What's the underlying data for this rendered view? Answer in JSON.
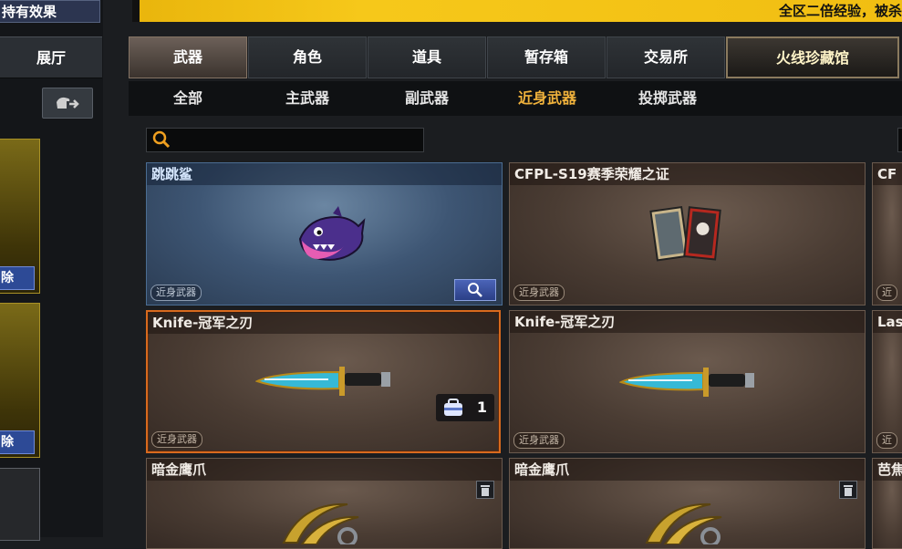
{
  "left": {
    "held_effect_label": "持有效果",
    "hall_label": "展厅",
    "remove_label": "除"
  },
  "banner": {
    "text": "全区二倍经验，被杀"
  },
  "main_tabs": [
    "武器",
    "角色",
    "道具",
    "暂存箱",
    "交易所",
    "火线珍藏馆"
  ],
  "sub_tabs": [
    "全部",
    "主武器",
    "副武器",
    "近身武器",
    "投掷武器"
  ],
  "search": {
    "placeholder": "",
    "value": ""
  },
  "cards": [
    {
      "title": "跳跳鲨",
      "tag": "近身武器"
    },
    {
      "title": "CFPL-S19赛季荣耀之证",
      "tag": "近身武器"
    },
    {
      "title": "CF",
      "tag": "近"
    },
    {
      "title": "Knife-冠军之刃",
      "tag": "近身武器",
      "count": "1"
    },
    {
      "title": "Knife-冠军之刃",
      "tag": "近身武器"
    },
    {
      "title": "Las",
      "tag": "近"
    },
    {
      "title": "暗金鹰爪"
    },
    {
      "title": "暗金鹰爪"
    },
    {
      "title": "芭焦"
    }
  ],
  "colors": {
    "accent_tab_active_text": "#f0b23c",
    "banner": "#f1be12",
    "selected_border": "#d86a1e",
    "remove_button": "#2d4a96"
  }
}
